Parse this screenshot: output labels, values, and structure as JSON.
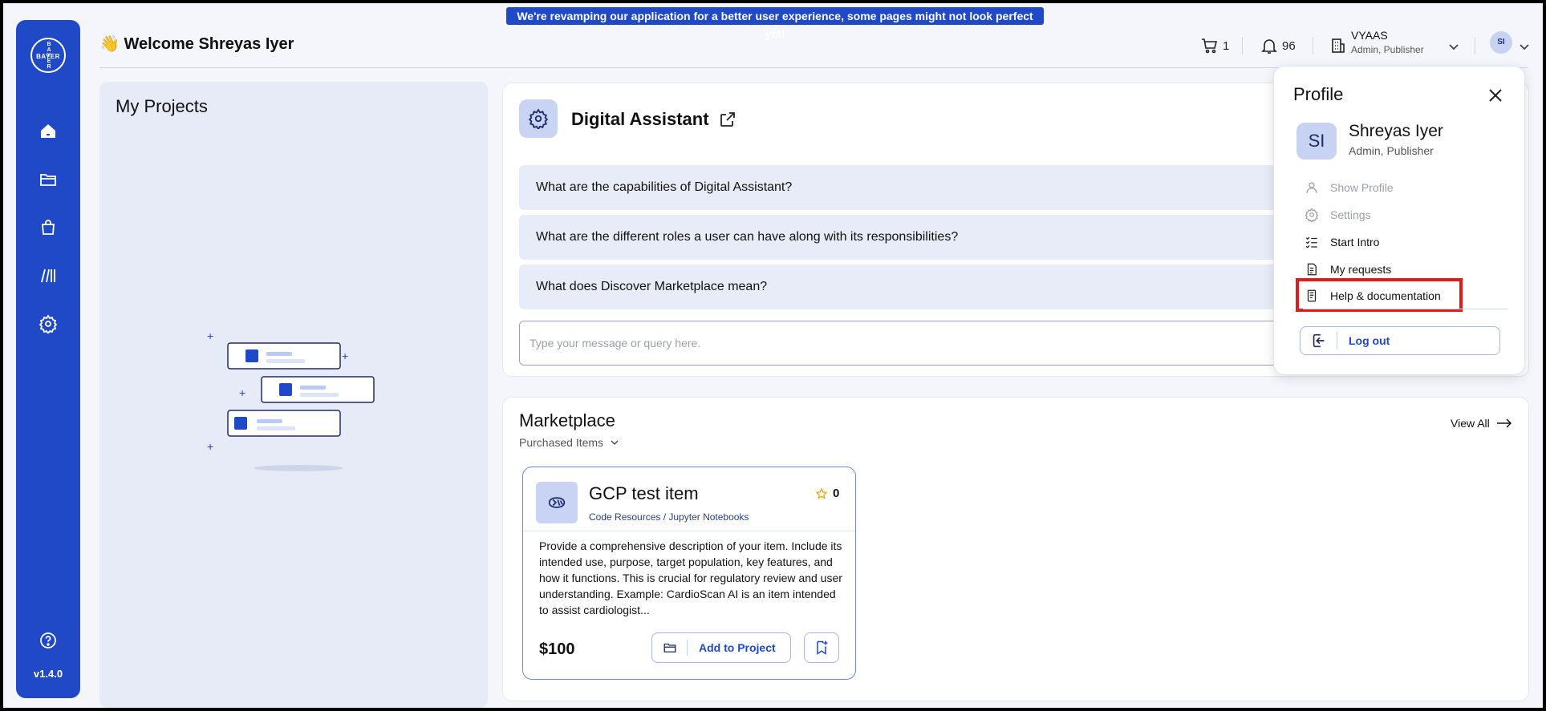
{
  "banner": {
    "text": "We're revamping our application for a better user experience, some pages might not look perfect yet!"
  },
  "sidebar": {
    "logo": {
      "vertical": [
        "B",
        "A",
        "Y",
        "E",
        "R"
      ],
      "horizontal": "BAYER"
    },
    "items": [
      {
        "icon": "home-icon"
      },
      {
        "icon": "folder-icon"
      },
      {
        "icon": "shopping-bag-icon"
      },
      {
        "icon": "library-icon"
      },
      {
        "icon": "settings-icon"
      },
      {
        "icon": "help-icon"
      }
    ],
    "version": "v1.4.0"
  },
  "header": {
    "wave": "👋",
    "welcome": "Welcome Shreyas Iyer",
    "cart_count": "1",
    "notification_count": "96",
    "org_name": "VYAAS",
    "org_role": "Admin, Publisher",
    "avatar_initials": "SI"
  },
  "projects": {
    "title": "My Projects"
  },
  "assistant": {
    "title": "Digital Assistant",
    "faqs": [
      "What are the capabilities of Digital Assistant?",
      "What are the different roles a user can have along with its responsibilities?",
      "What does Discover Marketplace mean?"
    ],
    "input_placeholder": "Type your message or query here."
  },
  "marketplace": {
    "title": "Marketplace",
    "filter": "Purchased Items",
    "view_all": "View All",
    "item": {
      "name": "GCP test item",
      "rating": "0",
      "category": "Code Resources / Jupyter Notebooks",
      "description": "Provide a comprehensive description of your item. Include its intended use, purpose, target population, key features, and how it functions. This is crucial for regulatory review and user understanding. Example: CardioScan AI is an item intended to assist cardiologist...",
      "price": "$100",
      "add_label": "Add to Project"
    }
  },
  "profile": {
    "title": "Profile",
    "initials": "SI",
    "name": "Shreyas Iyer",
    "role": "Admin, Publisher",
    "menu": [
      {
        "label": "Show Profile",
        "icon": "user-icon",
        "disabled": true
      },
      {
        "label": "Settings",
        "icon": "gear-icon",
        "disabled": true
      },
      {
        "label": "Start Intro",
        "icon": "checklist-icon",
        "disabled": false
      },
      {
        "label": "My requests",
        "icon": "document-icon",
        "disabled": false
      },
      {
        "label": "Help & documentation",
        "icon": "book-icon",
        "disabled": false
      }
    ],
    "logout": "Log out"
  },
  "colors": {
    "brand": "#1f49c6",
    "highlight": "#e21b1b",
    "panel": "#e6ebf7"
  }
}
